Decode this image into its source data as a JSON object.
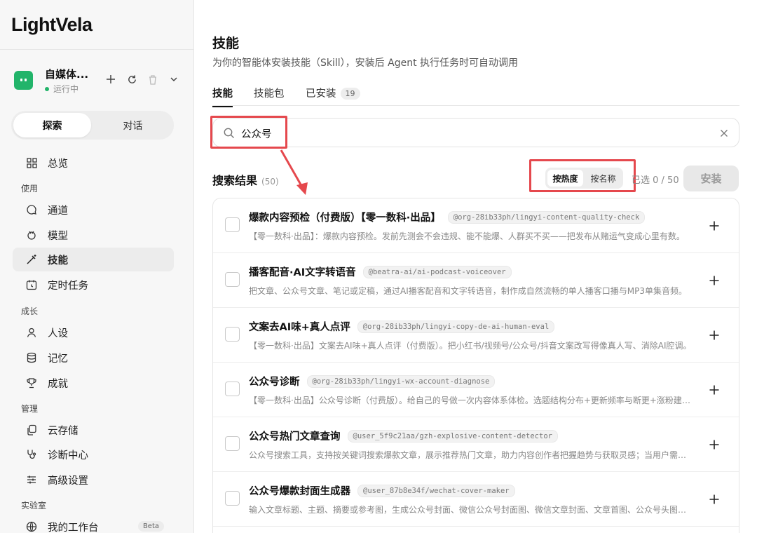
{
  "app": {
    "logo": "LightVela"
  },
  "agent": {
    "name": "自媒体...",
    "status": "运行中"
  },
  "sidebar": {
    "segments": [
      {
        "label": "探索",
        "active": true
      },
      {
        "label": "对话",
        "active": false
      }
    ],
    "groups": [
      {
        "label": "使用",
        "items": [
          {
            "label": "总览",
            "icon": "grid-icon"
          }
        ]
      }
    ],
    "overview": "总览",
    "group_use": "使用",
    "channel": "通道",
    "model": "模型",
    "skills": "技能",
    "scheduled": "定时任务",
    "group_growth": "成长",
    "persona": "人设",
    "memory": "记忆",
    "achievements": "成就",
    "group_manage": "管理",
    "cloud_storage": "云存储",
    "diagnostics": "诊断中心",
    "advanced": "高级设置",
    "group_lab": "实验室",
    "workbench": "我的工作台",
    "beta": "Beta"
  },
  "main": {
    "title": "技能",
    "subtitle": "为你的智能体安装技能（Skill），安装后 Agent 执行任务时可自动调用",
    "tabs": {
      "skills": "技能",
      "packs": "技能包",
      "installed": "已安装",
      "installed_count": "19"
    },
    "search": {
      "value": "公众号"
    },
    "results": {
      "title": "搜索结果",
      "count": "(50)"
    },
    "sort": {
      "by_popularity": "按热度",
      "by_name": "按名称"
    },
    "selected": "已选 0 / 50",
    "install": "安装",
    "rows": [
      {
        "title": "爆款内容预检（付费版）【零一数科·出品】",
        "slug": "@org-28ib33ph/lingyi-content-quality-check",
        "desc": "【零一数科·出品】：爆款内容预检。发前先测会不会违规、能不能爆、人群买不买——把发布从赌运气变成心里有数。"
      },
      {
        "title": "播客配音·AI文字转语音",
        "slug": "@beatra-ai/ai-podcast-voiceover",
        "desc": "把文章、公众号文章、笔记或定稿，通过AI播客配音和文字转语音，制作成自然流畅的单人播客口播与MP3单集音频。"
      },
      {
        "title": "文案去AI味+真人点评",
        "slug": "@org-28ib33ph/lingyi-copy-de-ai-human-eval",
        "desc": "【零一数科·出品】文案去AI味+真人点评（付费版）。把小红书/视频号/公众号/抖音文案改写得像真人写、消除AI腔调。"
      },
      {
        "title": "公众号诊断",
        "slug": "@org-28ib33ph/lingyi-wx-account-diagnose",
        "desc": "【零一数科·出品】公众号诊断（付费版）。给自己的号做一次内容体系体检。选题结构分布+更新频率与断更+涨粉建议。"
      },
      {
        "title": "公众号热门文章查询",
        "slug": "@user_5f9c21aa/gzh-explosive-content-detector",
        "desc": "公众号搜索工具，支持按关键词搜索爆款文章，展示推荐热门文章，助力内容创作者把握趋势与获取灵感；当用户需要查找。"
      },
      {
        "title": "公众号爆款封面生成器",
        "slug": "@user_87b8e34f/wechat-cover-maker",
        "desc": "输入文章标题、主题、摘要或参考图，生成公众号封面、微信公众号封面图、微信文章封面、文章首图、公众号头图等。"
      }
    ]
  }
}
